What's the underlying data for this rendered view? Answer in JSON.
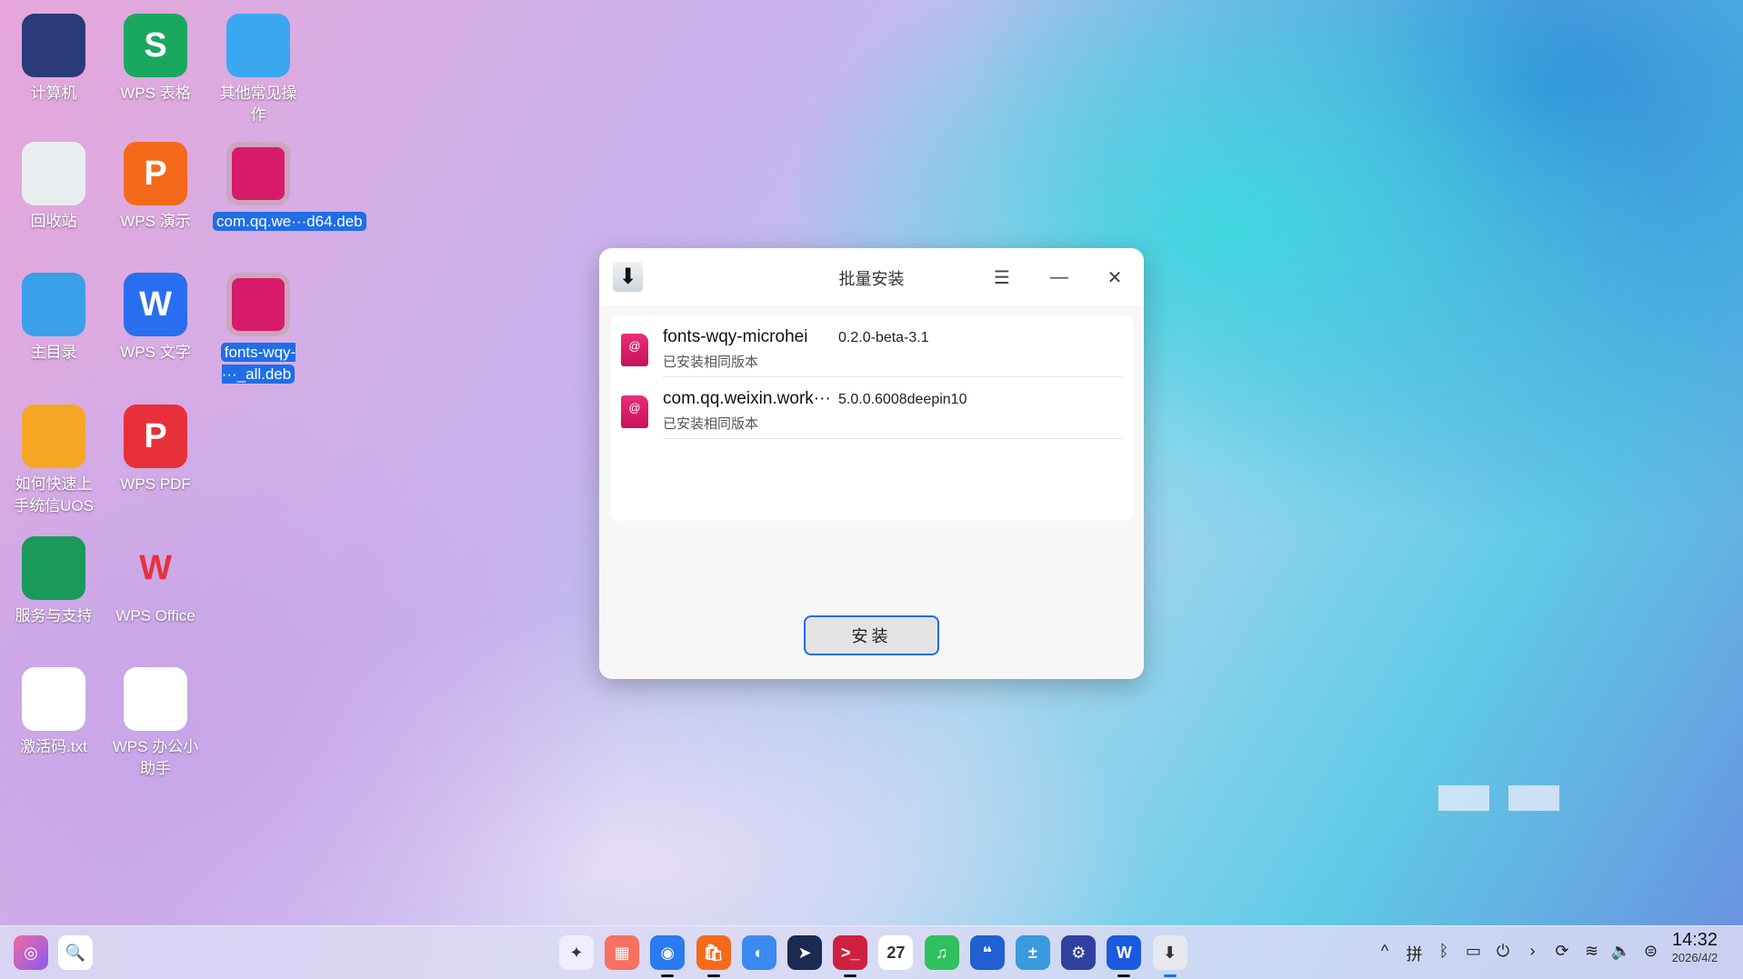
{
  "desktop": {
    "icons": [
      {
        "label": "计算机",
        "icon": "computer-icon",
        "color": "#2b3a7a"
      },
      {
        "label": "回收站",
        "icon": "trash-icon",
        "color": "#e8eef0"
      },
      {
        "label": "主目录",
        "icon": "home-folder-icon",
        "color": "#3aa0ea"
      },
      {
        "label": "如何快速上手统信UOS",
        "icon": "uos-guide-icon",
        "color": "#f5a623"
      },
      {
        "label": "服务与支持",
        "icon": "support-icon",
        "color": "#1a9a5a"
      },
      {
        "label": "激活码.txt",
        "icon": "text-file-icon",
        "color": "#ffffff"
      },
      {
        "label": "WPS 表格",
        "icon": "wps-sheets-icon",
        "color": "#1aa860",
        "glyph": "S"
      },
      {
        "label": "WPS 演示",
        "icon": "wps-presentation-icon",
        "color": "#f56a1a",
        "glyph": "P"
      },
      {
        "label": "WPS 文字",
        "icon": "wps-writer-icon",
        "color": "#2a6ef0",
        "glyph": "W"
      },
      {
        "label": "WPS PDF",
        "icon": "wps-pdf-icon",
        "color": "#e8303a",
        "glyph": "P"
      },
      {
        "label": "WPS Office",
        "icon": "wps-office-icon",
        "color": "transparent",
        "glyph": "W"
      },
      {
        "label": "WPS 办公小助手",
        "icon": "wps-assistant-icon",
        "color": "#ffffff"
      },
      {
        "label": "其他常见操作",
        "icon": "folder-icon",
        "color": "#3aa8f0"
      },
      {
        "label": "com.qq.we···d64.deb",
        "icon": "deb-package-icon",
        "color": "#d81b6a",
        "selected": true
      },
      {
        "label": "fonts-wqy-···_all.deb",
        "icon": "deb-package-icon",
        "color": "#d81b6a",
        "selected": true
      }
    ]
  },
  "dialog": {
    "title": "批量安装",
    "packages": [
      {
        "name": "fonts-wqy-microhei",
        "version": "0.2.0-beta-3.1",
        "status": "已安装相同版本"
      },
      {
        "name": "com.qq.weixin.work···",
        "version": "5.0.0.6008deepin10",
        "status": "已安装相同版本"
      }
    ],
    "install_label": "安装"
  },
  "taskbar": {
    "dock": [
      "launcher",
      "multitask-view",
      "file-manager",
      "app-store",
      "browser",
      "mail",
      "terminal",
      "calendar",
      "music",
      "notes",
      "calculator",
      "control-center",
      "wps-writer",
      "package-installer"
    ],
    "clock": {
      "time": "14:32",
      "date": "2026/4/2"
    }
  },
  "colors": {
    "accent": "#1f6ee8",
    "deb": "#d81b6a"
  }
}
